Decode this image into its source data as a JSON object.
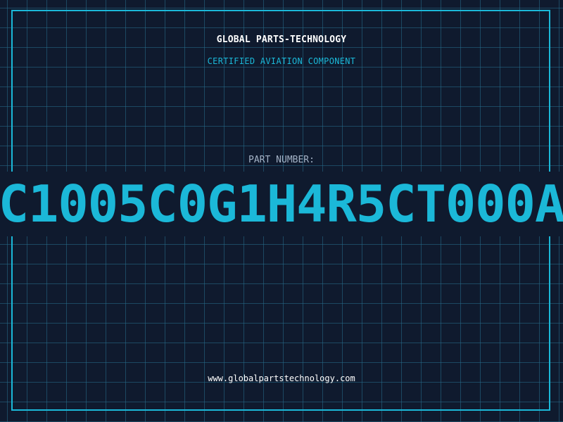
{
  "header": {
    "company_name": "GLOBAL PARTS-TECHNOLOGY",
    "tagline": "CERTIFIED AVIATION COMPONENT"
  },
  "part": {
    "label": "PART NUMBER:",
    "number": "C1005C0G1H4R5CT000A"
  },
  "footer": {
    "website": "www.globalpartstechnology.com"
  },
  "colors": {
    "background": "#0f1a2e",
    "accent": "#1bb8d8",
    "grid": "#266e8c",
    "label": "#a3b2c6",
    "text": "#ffffff"
  }
}
